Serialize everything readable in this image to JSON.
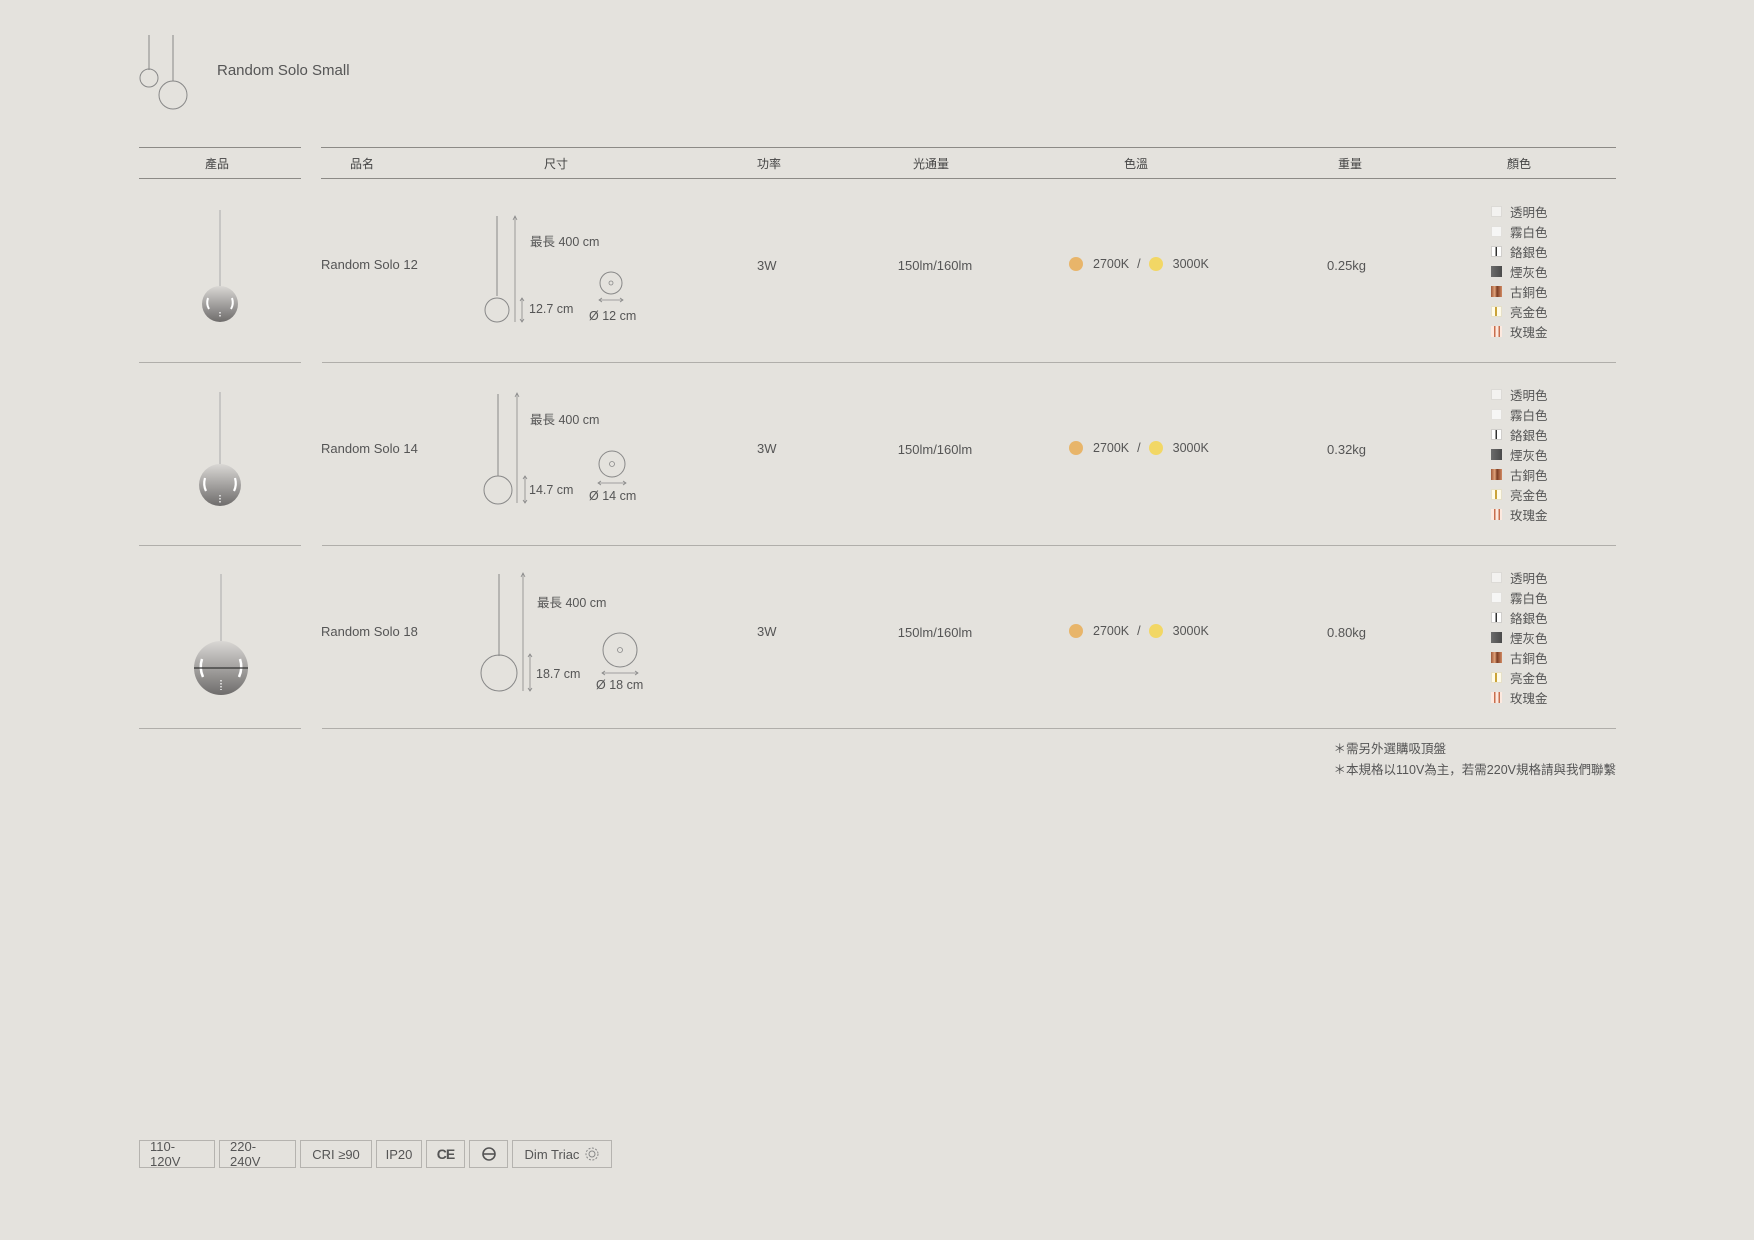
{
  "header": {
    "title": "Random Solo Small"
  },
  "columns": {
    "product": "產品",
    "name": "品名",
    "size": "尺寸",
    "power": "功率",
    "lumen": "光通量",
    "cct": "色溫",
    "weight": "重量",
    "color": "顏色"
  },
  "temps": {
    "warm": "2700K",
    "sep": "/",
    "neutral": "3000K",
    "warm_color": "#e8b56a",
    "neutral_color": "#f2d765"
  },
  "rows": [
    {
      "name": "Random Solo 12",
      "max_len": "最長 400 cm",
      "height": "12.7 cm",
      "diameter": "Ø 12 cm",
      "power": "3W",
      "lumen": "150lm/160lm",
      "weight": "0.25kg"
    },
    {
      "name": "Random Solo 14",
      "max_len": "最長 400 cm",
      "height": "14.7 cm",
      "diameter": "Ø 14 cm",
      "power": "3W",
      "lumen": "150lm/160lm",
      "weight": "0.32kg"
    },
    {
      "name": "Random Solo 18",
      "max_len": "最長 400 cm",
      "height": "18.7 cm",
      "diameter": "Ø 18 cm",
      "power": "3W",
      "lumen": "150lm/160lm",
      "weight": "0.80kg"
    }
  ],
  "color_options": [
    {
      "label": "透明色",
      "swatch": "clear"
    },
    {
      "label": "霧白色",
      "swatch": "white"
    },
    {
      "label": "鉻銀色",
      "swatch": "chrome"
    },
    {
      "label": "煙灰色",
      "swatch": "smoke"
    },
    {
      "label": "古銅色",
      "swatch": "bronze"
    },
    {
      "label": "亮金色",
      "swatch": "gold"
    },
    {
      "label": "玫瑰金",
      "swatch": "rose"
    }
  ],
  "notes": {
    "line1": "＊需另外選購吸頂盤",
    "line2": "＊本規格以110V為主，若需220V規格請與我們聯繫"
  },
  "badges": {
    "v110": "110-120V",
    "v220": "220-240V",
    "cri": "CRI ≥90",
    "ip": "IP20",
    "ce": "CE",
    "dim": "Dim Triac"
  }
}
